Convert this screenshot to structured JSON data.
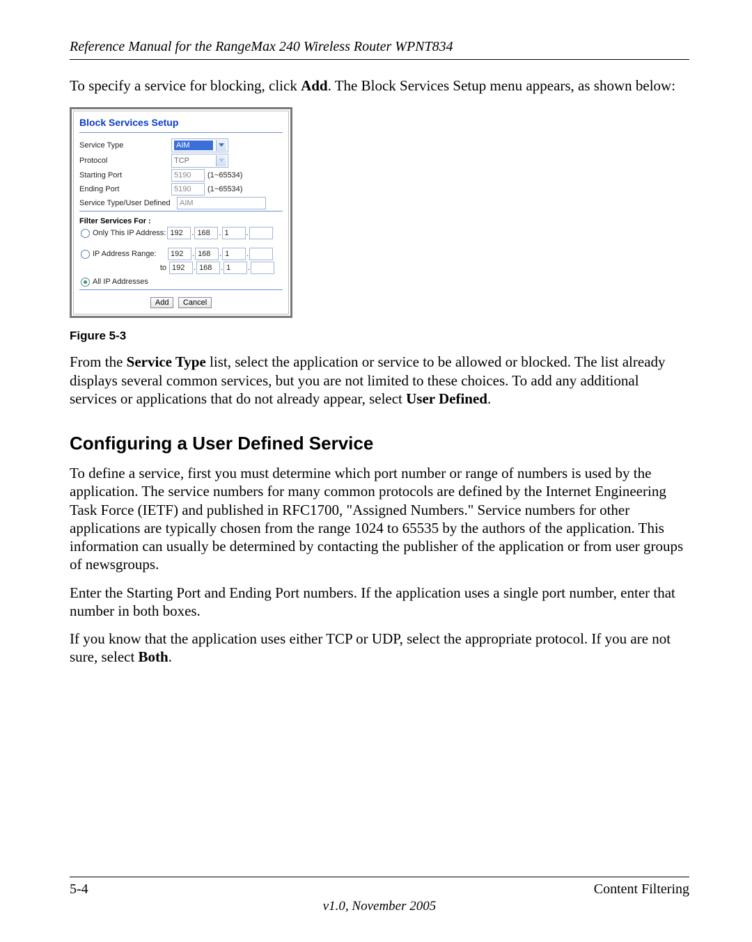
{
  "header": "Reference Manual for the RangeMax 240 Wireless Router WPNT834",
  "intro": {
    "pre": "To specify a service for blocking, click ",
    "bold": "Add",
    "post": ". The Block Services Setup menu appears, as shown below:"
  },
  "shot": {
    "title": "Block Services Setup",
    "labels": {
      "service_type": "Service Type",
      "protocol": "Protocol",
      "starting_port": "Starting Port",
      "ending_port": "Ending Port",
      "user_defined": "Service Type/User Defined"
    },
    "values": {
      "service_type": "AIM",
      "protocol": "TCP",
      "starting_port": "5190",
      "ending_port": "5190",
      "port_hint": "(1~65534)",
      "user_defined": "AIM"
    },
    "filter_heading": "Filter Services For :",
    "filter": {
      "only_ip_label": "Only This IP Address:",
      "range_label": "IP Address Range:",
      "to_label": "to",
      "all_label": "All IP Addresses",
      "ip1": [
        "192",
        "168",
        "1",
        ""
      ],
      "ip2": [
        "192",
        "168",
        "1",
        ""
      ],
      "ip3": [
        "192",
        "168",
        "1",
        ""
      ]
    },
    "buttons": {
      "add": "Add",
      "cancel": "Cancel"
    }
  },
  "fig_caption": "Figure 5-3",
  "para_service": {
    "a": "From the ",
    "b": "Service Type",
    "c": " list, select the application or service to be allowed or blocked. The list already displays several common services, but you are not limited to these choices. To add any additional services or applications that do not already appear, select ",
    "d": "User Defined",
    "e": "."
  },
  "h2": "Configuring a User Defined Service",
  "para_define": "To define a service, first you must determine which port number or range of numbers is used by the application. The service numbers for many common protocols are defined by the Internet Engineering Task Force (IETF) and published in RFC1700, \"Assigned Numbers.\" Service numbers for other applications are typically chosen from the range 1024 to 65535 by the authors of the application. This information can usually be determined by contacting the publisher of the application or from user groups of newsgroups.",
  "para_ports": "Enter the Starting Port and Ending Port numbers. If the application uses a single port number, enter that number in both boxes.",
  "para_proto": {
    "a": "If you know that the application uses either TCP or UDP, select the appropriate protocol. If you are not sure, select ",
    "b": "Both",
    "c": "."
  },
  "footer": {
    "page": "5-4",
    "section": "Content Filtering",
    "version": "v1.0, November 2005"
  }
}
